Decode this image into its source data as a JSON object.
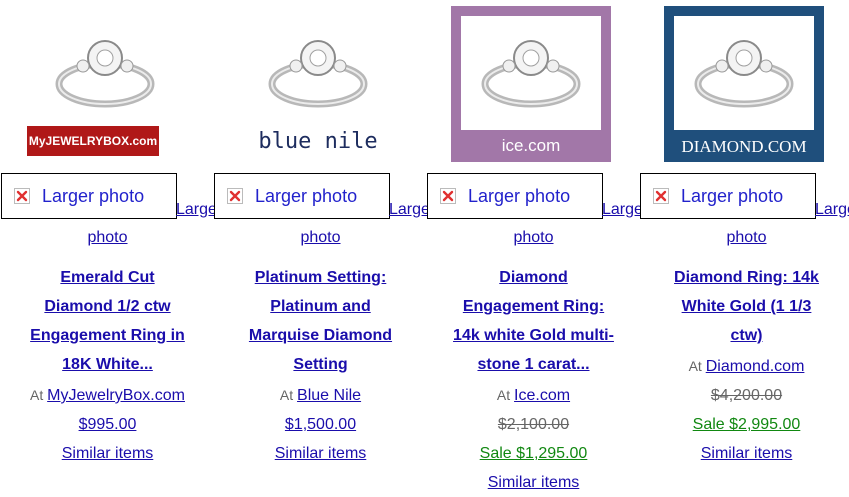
{
  "products": [
    {
      "logo_text": "MyJEWELRYBOX.com",
      "broken_label": "Larger photo",
      "overflow_text": "Larger",
      "tail_text": "photo",
      "title_lines": [
        "Emerald Cut",
        "Diamond 1/2 ctw",
        "Engagement Ring in",
        "18K White..."
      ],
      "at_label": "At",
      "store": "MyJewelryBox.com",
      "price": "$995.00",
      "old_price": "",
      "sale_price": "",
      "similar": "Similar items",
      "logo_bg": "#b01818",
      "logo_color": "#ffffff"
    },
    {
      "logo_text": "blue nile",
      "broken_label": "Larger photo",
      "overflow_text": "Larger",
      "tail_text": "photo",
      "title_lines": [
        "Platinum Setting:",
        "Platinum and",
        "Marquise Diamond",
        "Setting"
      ],
      "at_label": "At",
      "store": "Blue Nile",
      "price": "$1,500.00",
      "old_price": "",
      "sale_price": "",
      "similar": "Similar items",
      "logo_bg": "#ffffff",
      "logo_color": "#1d2c5e"
    },
    {
      "logo_text": "ice.com",
      "broken_label": "Larger photo",
      "overflow_text": "Larger",
      "tail_text": "photo",
      "title_lines": [
        "Diamond",
        "Engagement Ring:",
        "14k white Gold multi-",
        "stone 1 carat..."
      ],
      "at_label": "At",
      "store": "Ice.com",
      "price": "",
      "old_price": "$2,100.00",
      "sale_price": "Sale $1,295.00",
      "similar": "Similar items",
      "logo_bg": "#a277a8",
      "logo_color": "#ffffff"
    },
    {
      "logo_text": "DIAMOND.COM",
      "broken_label": "Larger photo",
      "overflow_text": "Larger",
      "tail_text": "photo",
      "title_lines": [
        "Diamond Ring: 14k",
        "White Gold (1 1/3",
        "ctw)"
      ],
      "at_label": "At",
      "store": "Diamond.com",
      "price": "",
      "old_price": "$4,200.00",
      "sale_price": "Sale $2,995.00",
      "similar": "Similar items",
      "logo_bg": "#1f4f7c",
      "logo_color": "#ffffff"
    }
  ]
}
